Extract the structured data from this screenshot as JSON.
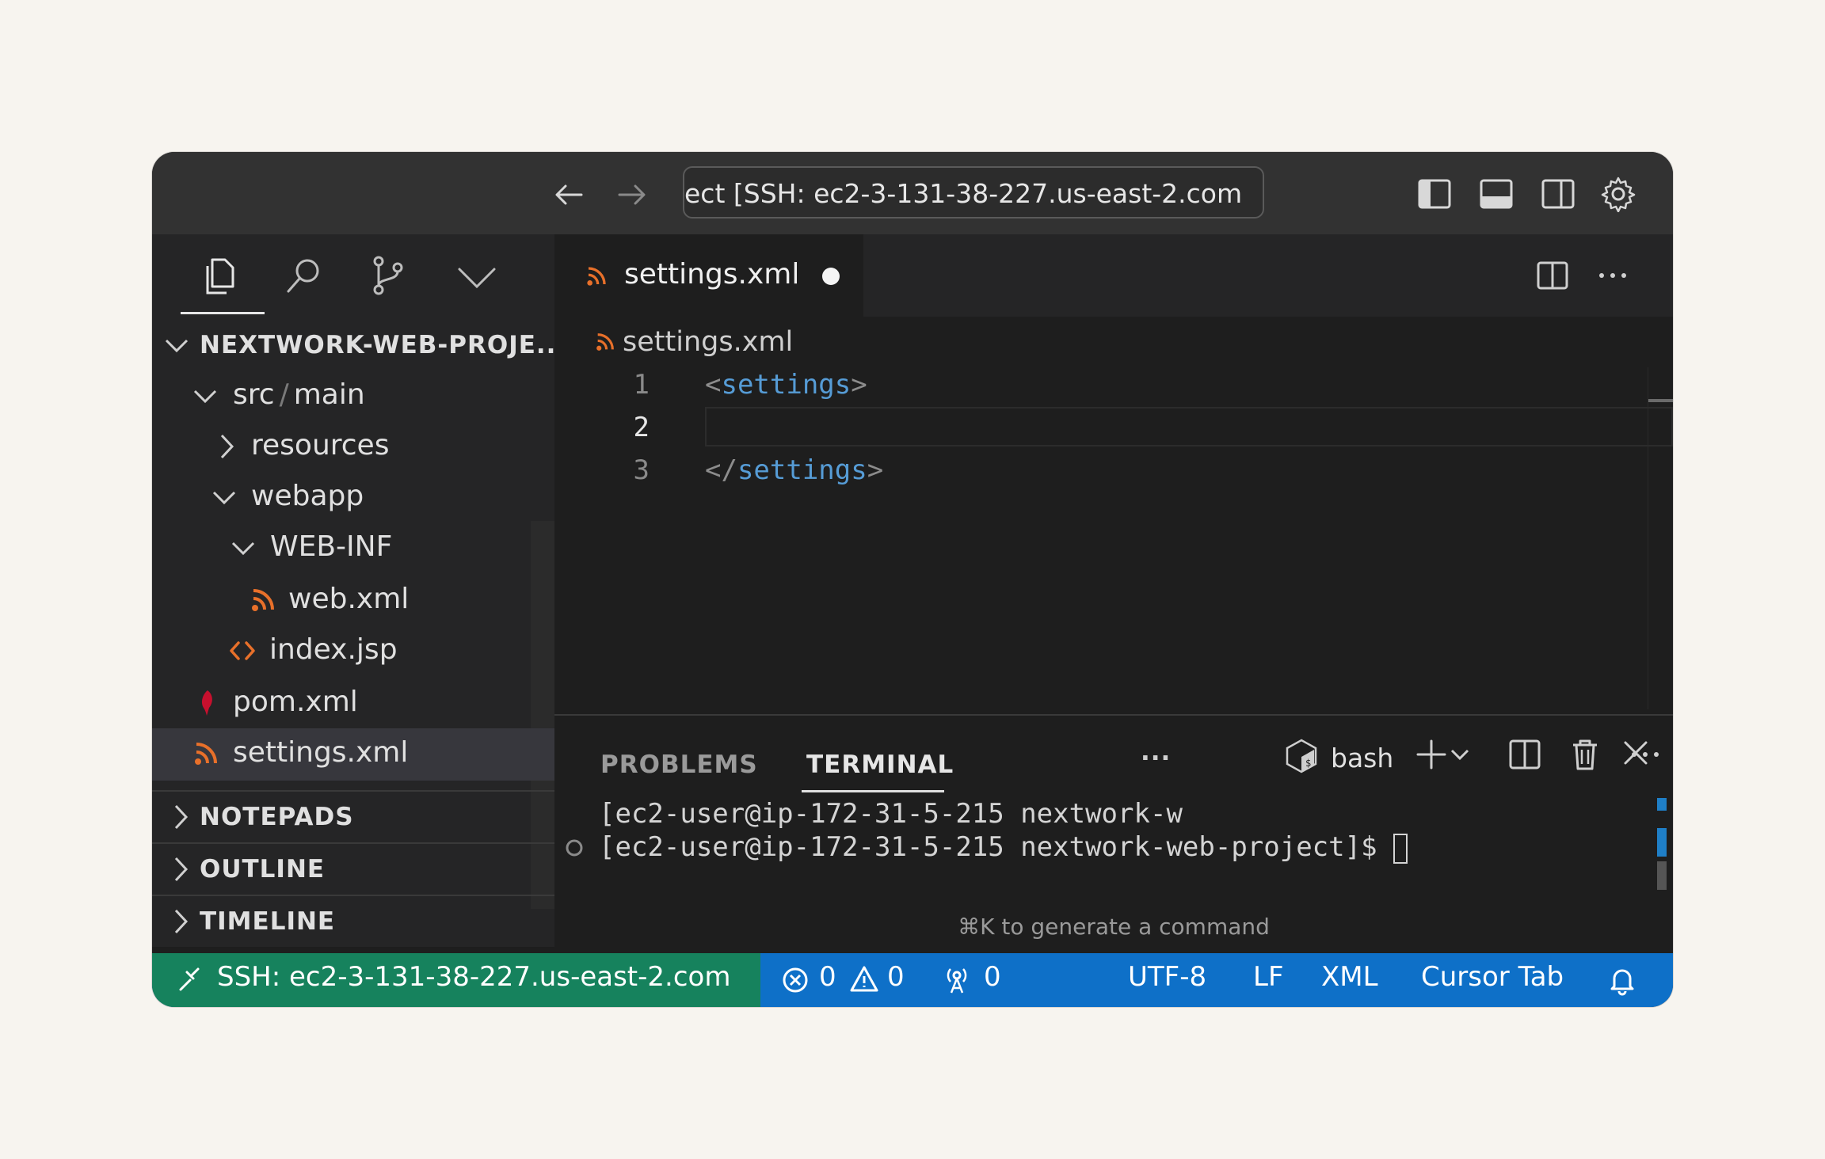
{
  "titlebar": {
    "back_icon": "arrow-left-icon",
    "forward_icon": "arrow-right-icon",
    "command_center_text": "ect [SSH: ec2-3-131-38-227.us-east-2.com",
    "icons": [
      "toggle-primary-sidebar-icon",
      "toggle-panel-icon",
      "toggle-secondary-sidebar-icon",
      "settings-gear-icon"
    ]
  },
  "sidebar": {
    "activity_icons": [
      "explorer-icon",
      "search-icon",
      "source-control-icon",
      "chevron-down-icon"
    ],
    "root_label": "NEXTWORK-WEB-PROJE...",
    "tree": [
      {
        "label_a": "src",
        "label_sep": "/",
        "label_b": "main"
      },
      {
        "label": "resources"
      },
      {
        "label": "webapp"
      },
      {
        "label": "WEB-INF"
      },
      {
        "label": "web.xml",
        "icon": "rss-xml-icon"
      },
      {
        "label": "index.jsp",
        "icon": "code-brackets-icon"
      },
      {
        "label": "pom.xml",
        "icon": "maven-feather-icon"
      },
      {
        "label": "settings.xml",
        "icon": "rss-xml-icon"
      }
    ],
    "sections": [
      "NOTEPADS",
      "OUTLINE",
      "TIMELINE"
    ]
  },
  "editor": {
    "tab_label": "settings.xml",
    "breadcrumb": "settings.xml",
    "lines": [
      {
        "num": "1",
        "open": "<",
        "tag": "settings",
        "close": ">"
      },
      {
        "num": "2"
      },
      {
        "num": "3",
        "open": "</",
        "tag": "settings",
        "close": ">"
      }
    ]
  },
  "panel": {
    "tabs": [
      "PROBLEMS",
      "TERMINAL",
      "···"
    ],
    "shell_label": "bash",
    "term_lines": [
      "[ec2-user@ip-172-31-5-215 nextwork-w",
      "[ec2-user@ip-172-31-5-215 nextwork-web-project]$ "
    ],
    "hint": "⌘K to generate a command"
  },
  "statusbar": {
    "remote_label": "SSH: ec2-3-131-38-227.us-east-2.com",
    "errors": "0",
    "warnings": "0",
    "ports": "0",
    "encoding": "UTF-8",
    "eol": "LF",
    "language": "XML",
    "cursor_tab": "Cursor Tab"
  },
  "colors": {
    "statusbar_blue": "#0e70c8",
    "remote_green": "#16825d",
    "xml_orange": "#e8702a",
    "tag_blue": "#569cd6"
  }
}
